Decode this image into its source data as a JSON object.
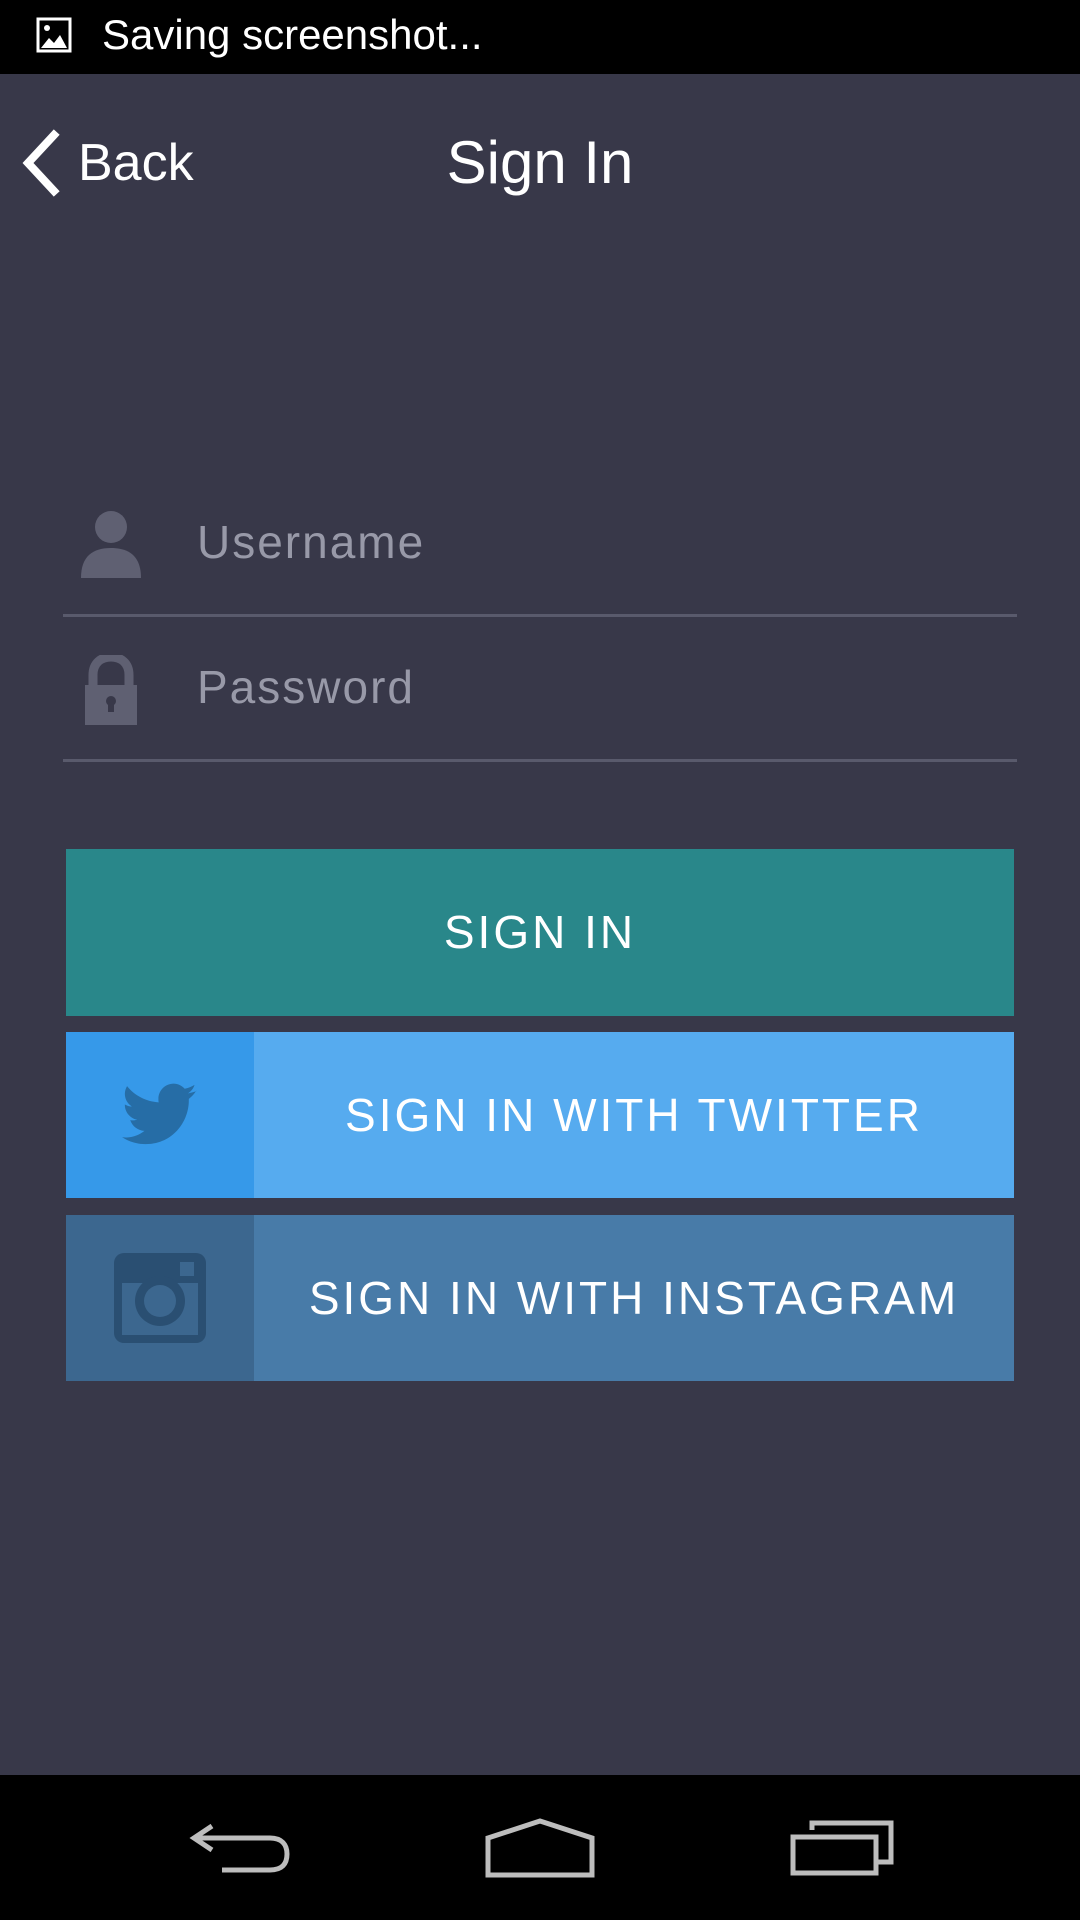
{
  "status_bar": {
    "notification_text": "Saving screenshot...",
    "icon": "image-icon"
  },
  "header": {
    "back_label": "Back",
    "title": "Sign In",
    "back_icon": "chevron-left-icon"
  },
  "form": {
    "username": {
      "placeholder": "Username",
      "value": "",
      "icon": "user-icon"
    },
    "password": {
      "placeholder": "Password",
      "value": "",
      "icon": "lock-icon"
    }
  },
  "buttons": {
    "sign_in": "SIGN IN",
    "twitter": "SIGN IN WITH TWITTER",
    "instagram": "SIGN IN WITH INSTAGRAM"
  },
  "colors": {
    "background": "#383849",
    "sign_in": "#29878a",
    "twitter": "#56abef",
    "twitter_icon_panel": "#3699e9",
    "instagram": "#487ba8",
    "instagram_icon_panel": "#3c678f",
    "field_underline": "#595a6c",
    "placeholder": "#9899a8"
  },
  "nav_bar": {
    "buttons": [
      "back-nav-icon",
      "home-nav-icon",
      "recents-nav-icon"
    ]
  }
}
